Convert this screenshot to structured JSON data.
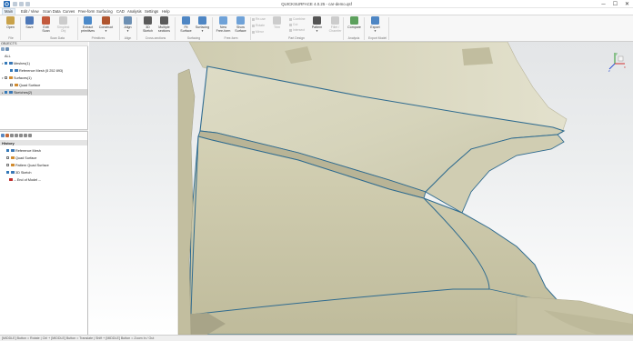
{
  "window": {
    "title": "QUICKSURFACE 4.0.25 - car-demo.qsf",
    "minimize": "─",
    "maximize": "☐",
    "close": "✕"
  },
  "menu": [
    "Main",
    "Edit / View",
    "Scan Data",
    "Curves",
    "Free-form",
    "Surfacing",
    "CAD",
    "Analysis",
    "Settings",
    "Help"
  ],
  "ribbon": {
    "buttons": [
      {
        "label": "Open",
        "color": "#c9a24a",
        "group": "file",
        "disabled": false
      },
      {
        "label": "Save",
        "color": "#4d78b8",
        "group": "file",
        "disabled": false
      },
      {
        "label": "Edit\nScan",
        "color": "#c35a3d",
        "group": "scan",
        "disabled": false
      },
      {
        "label": "Simplest\nObj",
        "color": "#cccccc",
        "group": "scan",
        "disabled": true
      },
      {
        "label": "Extract\nprimitives",
        "color": "#4b89c9",
        "group": "prim",
        "disabled": false
      },
      {
        "label": "Construct\n▾",
        "color": "#b0552f",
        "group": "prim",
        "disabled": false
      },
      {
        "label": "Align\n▾",
        "color": "#6c8fb3",
        "group": "align",
        "disabled": false
      },
      {
        "label": "3D\nSketch",
        "color": "#5a5a5a",
        "group": "cross",
        "disabled": false
      },
      {
        "label": "Multiple\nsections",
        "color": "#5a5a5a",
        "group": "cross",
        "disabled": false
      },
      {
        "label": "Fit\nSurface",
        "color": "#4e86c4",
        "group": "surf",
        "disabled": false
      },
      {
        "label": "Surfacing\n▾",
        "color": "#4e86c4",
        "group": "surf",
        "disabled": false
      },
      {
        "label": "New\nFree-form",
        "color": "#6fa2d8",
        "group": "ff",
        "disabled": false
      },
      {
        "label": "Show\nSurface",
        "color": "#6fa2d8",
        "group": "ff",
        "disabled": false
      },
      {
        "label": "Trim",
        "color": "#cccccc",
        "group": "part",
        "disabled": true
      },
      {
        "label": "Pattern\n▾",
        "color": "#555555",
        "group": "part",
        "disabled": false
      },
      {
        "label": "Fillet /\nChamfer",
        "color": "#cccccc",
        "group": "part",
        "disabled": true
      },
      {
        "label": "Compare",
        "color": "#5ca05c",
        "group": "analysis",
        "disabled": false
      },
      {
        "label": "Export\n▾",
        "color": "#4e86c4",
        "group": "export",
        "disabled": false
      }
    ],
    "small_buttons": [
      "Re-use",
      "Rotate",
      "Combine",
      "Cut",
      "Intersect",
      "Mirror"
    ],
    "groups": [
      "File",
      "Scan Data",
      "Primitives",
      "Align",
      "Cross-sections",
      "Surfacing",
      "Free-form",
      "Part Design",
      "Analysis",
      "Export Model"
    ]
  },
  "objects_panel": {
    "title": "OBJECTS",
    "tree": [
      {
        "label": "ALL",
        "level": 0,
        "twisty": "",
        "checked": false,
        "icon": "",
        "selected": false
      },
      {
        "label": "Meshes(1)",
        "level": 0,
        "twisty": "▾",
        "checked": true,
        "icon": "#3a78b6",
        "selected": false
      },
      {
        "label": "Reference Mesh (5 252 893)",
        "level": 1,
        "twisty": "",
        "checked": true,
        "icon": "#3a78b6",
        "selected": false
      },
      {
        "label": "Surfaces(1)",
        "level": 0,
        "twisty": "▾",
        "checked": false,
        "icon": "#d08b2f",
        "selected": false
      },
      {
        "label": "Quad Surface",
        "level": 1,
        "twisty": "",
        "checked": false,
        "icon": "#d08b2f",
        "selected": false
      },
      {
        "label": "Sketches(2)",
        "level": 0,
        "twisty": "▸",
        "checked": true,
        "icon": "#3a78b6",
        "selected": true
      }
    ]
  },
  "history_panel": {
    "header": "History",
    "items": [
      {
        "label": "Reference Mesh",
        "checked": true,
        "icon": "#3a78b6"
      },
      {
        "label": "Quad Surface",
        "checked": false,
        "icon": "#d08b2f"
      },
      {
        "label": "Pattern Quad Surface",
        "checked": false,
        "icon": "#d08b2f"
      },
      {
        "label": "3D Sketch",
        "checked": true,
        "icon": "#3a78b6"
      },
      {
        "label": "-- End of Model --",
        "checked": false,
        "icon": "#c03030"
      }
    ]
  },
  "viewcube": {
    "x": "x",
    "y": "y",
    "z": "z"
  },
  "status": "[MIDDLE] Button = Rotate | Ctrl + [MIDDLE] Button = Translate | Shift + [MIDDLE] Button = Zoom In / Out"
}
